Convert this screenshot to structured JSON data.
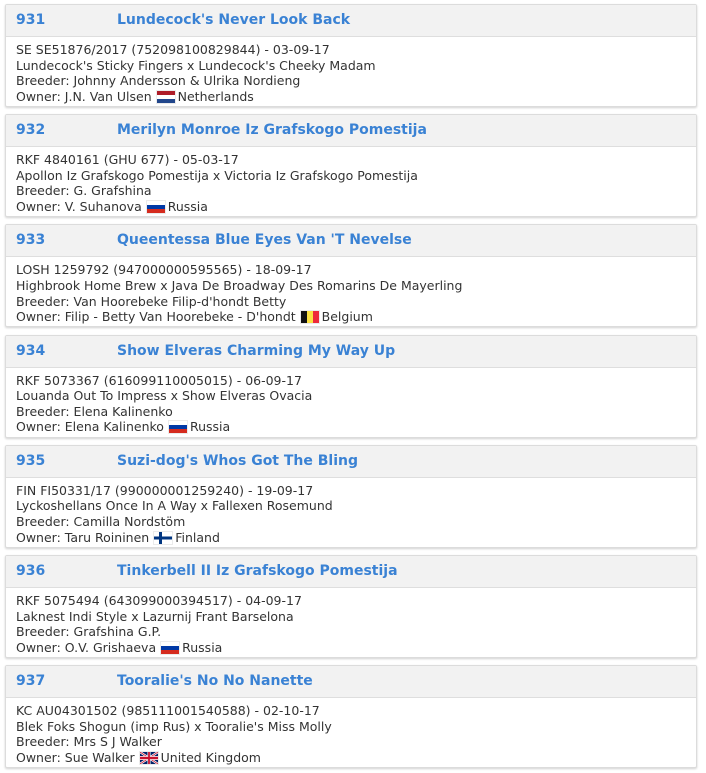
{
  "entries": [
    {
      "number": "931",
      "name": "Lundecock's Never Look Back",
      "registration": "SE SE51876/2017 (752098100829844) - 03-09-17",
      "parents": "Lundecock's Sticky Fingers x Lundecock's Cheeky Madam",
      "breeder": "Breeder: Johnny Andersson & Ulrika Nordieng",
      "owner": "Owner: J.N. Van Ulsen",
      "country": "Netherlands",
      "flag": "flag-nl"
    },
    {
      "number": "932",
      "name": "Merilyn Monroe Iz Grafskogo Pomestija",
      "registration": "RKF 4840161 (GHU 677) - 05-03-17",
      "parents": "Apollon Iz Grafskogo Pomestija x Victoria Iz Grafskogo Pomestija",
      "breeder": "Breeder: G. Grafshina",
      "owner": "Owner: V. Suhanova",
      "country": "Russia",
      "flag": "flag-ru"
    },
    {
      "number": "933",
      "name": "Queentessa Blue Eyes Van 'T Nevelse",
      "registration": "LOSH 1259792 (947000000595565) - 18-09-17",
      "parents": "Highbrook Home Brew x Java De Broadway Des Romarins De Mayerling",
      "breeder": "Breeder: Van Hoorebeke Filip-d'hondt Betty",
      "owner": "Owner: Filip - Betty Van Hoorebeke - D'hondt",
      "country": "Belgium",
      "flag": "flag-be"
    },
    {
      "number": "934",
      "name": "Show Elveras Charming My Way Up",
      "registration": "RKF 5073367 (616099110005015) - 06-09-17",
      "parents": "Louanda Out To Impress x Show Elveras Ovacia",
      "breeder": "Breeder: Elena Kalinenko",
      "owner": "Owner: Elena Kalinenko",
      "country": "Russia",
      "flag": "flag-ru"
    },
    {
      "number": "935",
      "name": "Suzi-dog's Whos Got The Bling",
      "registration": "FIN FI50331/17 (990000001259240) - 19-09-17",
      "parents": "Lyckoshellans Once In A Way x Fallexen Rosemund",
      "breeder": "Breeder: Camilla Nordstöm",
      "owner": "Owner: Taru Roininen",
      "country": "Finland",
      "flag": "flag-fi"
    },
    {
      "number": "936",
      "name": "Tinkerbell II Iz Grafskogo Pomestija",
      "registration": "RKF 5075494 (643099000394517) - 04-09-17",
      "parents": "Laknest Indi Style x Lazurnij Frant Barselona",
      "breeder": "Breeder: Grafshina G.P.",
      "owner": "Owner: O.V. Grishaeva",
      "country": "Russia",
      "flag": "flag-ru"
    },
    {
      "number": "937",
      "name": "Tooralie's No No Nanette",
      "registration": "KC AU04301502 (985111001540588) - 02-10-17",
      "parents": "Blek Foks Shogun (imp Rus) x Tooralie's Miss Molly",
      "breeder": "Breeder: Mrs S J Walker",
      "owner": "Owner: Sue Walker",
      "country": "United Kingdom",
      "flag": "flag-gb"
    }
  ],
  "colors": {
    "accent": "#3a82d4",
    "header_bg": "#f2f2f2",
    "text": "#333333",
    "border": "#dcdcdc"
  }
}
